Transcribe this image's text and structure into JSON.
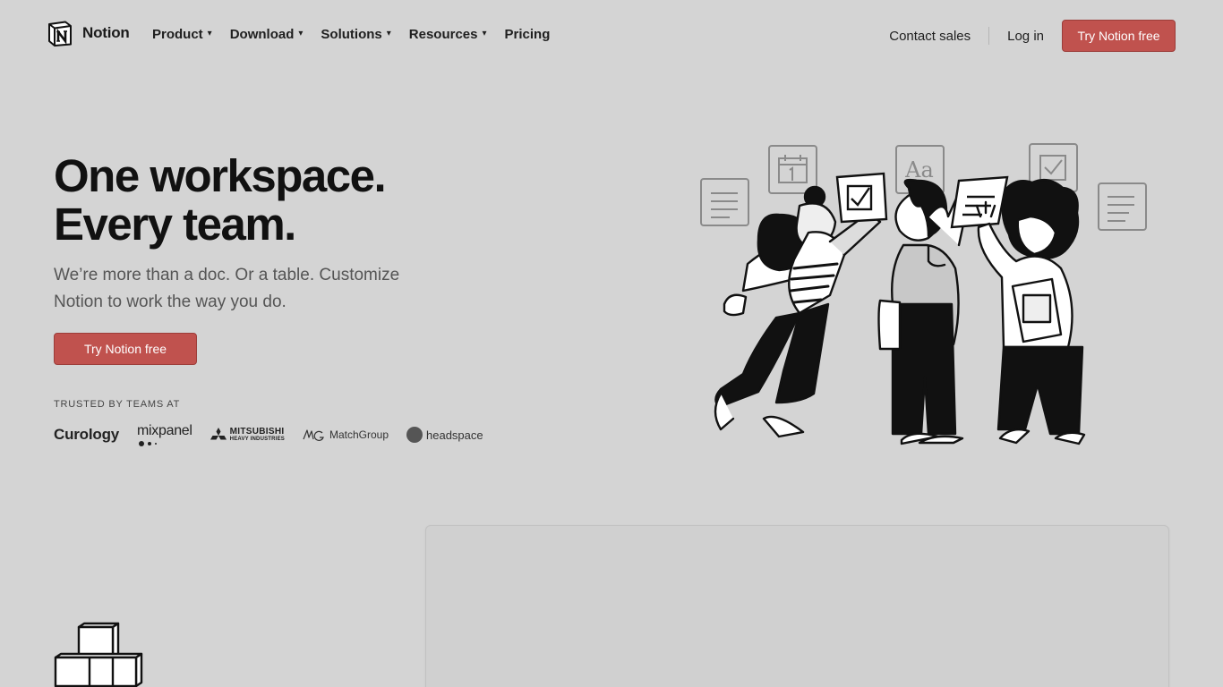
{
  "brand": {
    "name": "Notion",
    "accent": "#c0524e"
  },
  "nav": {
    "items": [
      {
        "label": "Product",
        "has_menu": true
      },
      {
        "label": "Download",
        "has_menu": true
      },
      {
        "label": "Solutions",
        "has_menu": true
      },
      {
        "label": "Resources",
        "has_menu": true
      },
      {
        "label": "Pricing",
        "has_menu": false
      }
    ],
    "contact_sales": "Contact sales",
    "login": "Log in",
    "cta": "Try Notion free"
  },
  "hero": {
    "title_line1": "One workspace.",
    "title_line2": "Every team.",
    "subtitle": "We’re more than a doc. Or a table. Customize Notion to work the way you do.",
    "cta": "Try Notion free",
    "trusted_label": "TRUSTED BY TEAMS AT",
    "logos": {
      "curology": "Curology",
      "mixpanel": "mixpanel",
      "mitsubishi_main": "MITSUBISHI",
      "mitsubishi_sub": "HEAVY INDUSTRIES",
      "matchgroup": "MatchGroup",
      "headspace": "headspace"
    }
  },
  "icons": {
    "chevron": "chevron-down-icon",
    "illustration": "team-illustration",
    "blocks": "blocks-icon"
  }
}
